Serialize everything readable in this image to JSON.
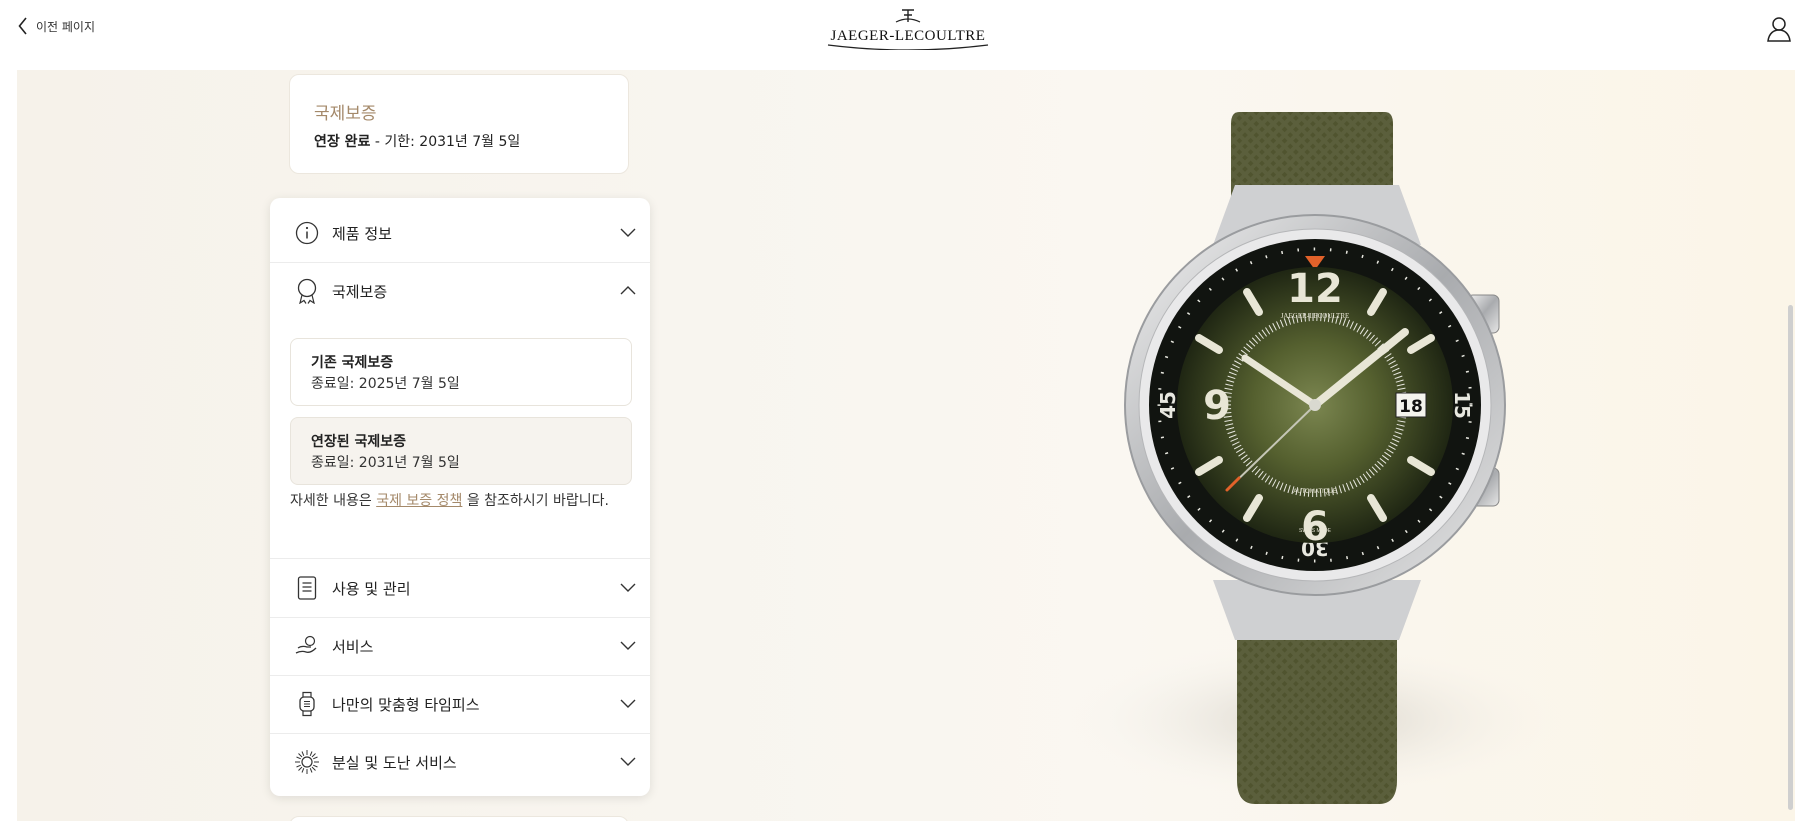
{
  "header": {
    "back_label": "이전 페이지",
    "brand": "JAEGER-LECOULTRE"
  },
  "warranty_summary": {
    "title": "국제보증",
    "status": "연장 완료",
    "deadline": " - 기한: 2031년 7월 5일"
  },
  "accordion": {
    "items": [
      {
        "label": "제품 정보",
        "icon": "info-icon",
        "expanded": false
      },
      {
        "label": "국제보증",
        "icon": "badge-icon",
        "expanded": true
      },
      {
        "label": "사용 및 관리",
        "icon": "document-icon",
        "expanded": false
      },
      {
        "label": "서비스",
        "icon": "service-hand-icon",
        "expanded": false
      },
      {
        "label": "나만의 맞춤형 타임피스",
        "icon": "watch-icon",
        "expanded": false
      },
      {
        "label": "분실 및 도난 서비스",
        "icon": "sun-icon",
        "expanded": false
      }
    ],
    "warranty_detail": {
      "original_title": "기존 국제보증",
      "original_end": "종료일: 2025년 7월 5일",
      "extended_title": "연장된 국제보증",
      "extended_end": "종료일: 2031년 7월 5일",
      "note_prefix": "자세한 내용은 ",
      "note_link": "국제 보증 정책",
      "note_suffix": " 을 참조하시기 바랍니다."
    }
  },
  "watch_dial": {
    "brand": "JAEGER-LECOULTRE",
    "numerals": [
      "12",
      "6",
      "9"
    ],
    "bezel_numerals": [
      "45",
      "15",
      "30"
    ],
    "date": "18",
    "automatic_label": "AUTOMATIQUE",
    "swiss_made": "SWISS  MADE"
  },
  "colors": {
    "accent": "#a4896a",
    "strap": "#5b5f3c",
    "dial": "#3f4a25"
  }
}
